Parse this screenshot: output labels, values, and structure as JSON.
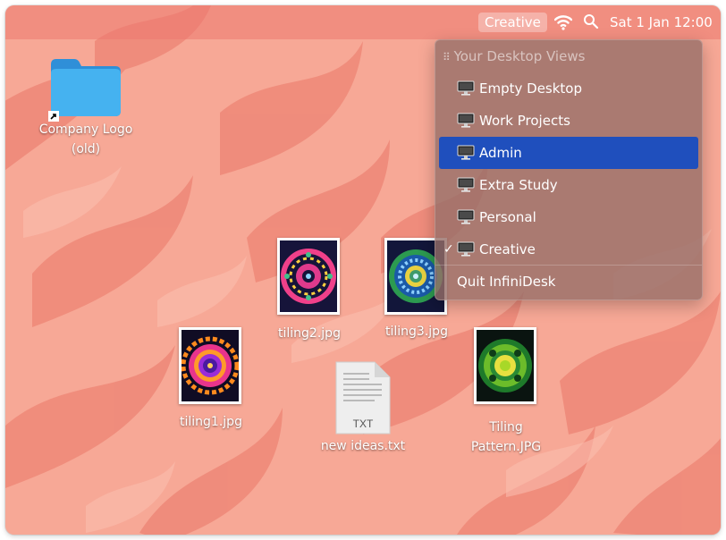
{
  "menubar": {
    "active_view_badge": "Creative",
    "icons": [
      "wifi-icon",
      "search-icon"
    ],
    "clock": "Sat 1 Jan 12:00"
  },
  "desktop": {
    "folder": {
      "label_line1": "Company Logo",
      "label_line2": "(old)",
      "icon": "folder-icon",
      "alias_badge": "alias-arrow-icon"
    },
    "files": [
      {
        "label": "tiling2.jpg",
        "kind": "image-thumbnail"
      },
      {
        "label": "tiling3.jpg",
        "kind": "image-thumbnail"
      },
      {
        "label": "tiling1.jpg",
        "kind": "image-thumbnail"
      },
      {
        "label": "new ideas.txt",
        "kind": "text-document",
        "badge": "TXT"
      },
      {
        "label_line1": "Tiling",
        "label_line2": "Pattern.JPG",
        "kind": "image-thumbnail"
      }
    ]
  },
  "views_menu": {
    "header": "Your Desktop Views",
    "items": [
      {
        "label": "Empty Desktop",
        "icon": "monitor-icon",
        "selected": false,
        "checked": false
      },
      {
        "label": "Work Projects",
        "icon": "monitor-icon",
        "selected": false,
        "checked": false
      },
      {
        "label": "Admin",
        "icon": "monitor-icon",
        "selected": true,
        "checked": false
      },
      {
        "label": "Extra Study",
        "icon": "monitor-icon",
        "selected": false,
        "checked": false
      },
      {
        "label": "Personal",
        "icon": "monitor-icon",
        "selected": false,
        "checked": false
      },
      {
        "label": "Creative",
        "icon": "monitor-icon",
        "selected": false,
        "checked": true
      }
    ],
    "check_glyph": "✓",
    "quit_label": "Quit InfiniDesk"
  },
  "colors": {
    "wallpaper_base": "#f7a896",
    "wallpaper_leaf": "#ee8878",
    "selection": "#1f4fbd",
    "folder_blue": "#3aa8e8"
  }
}
